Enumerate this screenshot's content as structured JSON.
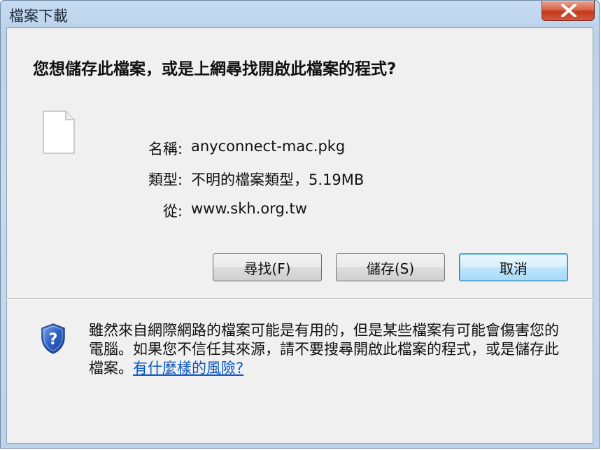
{
  "dialog": {
    "title": "檔案下載",
    "question": "您想儲存此檔案，或是上網尋找開啟此檔案的程式?",
    "file_icon": "blank-file-icon"
  },
  "file_info": {
    "name_label": "名稱:",
    "name_value": "anyconnect-mac.pkg",
    "type_label": "類型:",
    "type_value": "不明的檔案類型，5.19MB",
    "from_label": "從:",
    "from_value": "www.skh.org.tw"
  },
  "buttons": {
    "find": "尋找(F)",
    "save": "儲存(S)",
    "cancel": "取消"
  },
  "warning": {
    "icon": "security-shield-question-icon",
    "text": "雖然來自網際網路的檔案可能是有用的，但是某些檔案有可能會傷害您的電腦。如果您不信任其來源，請不要搜尋開啟此檔案的程式，或是儲存此檔案。",
    "link": "有什麼樣的風險?"
  },
  "colors": {
    "accent_link": "#0b56c4",
    "close_button": "#c4391c"
  }
}
